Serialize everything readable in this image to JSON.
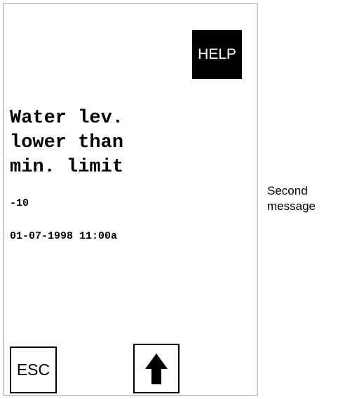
{
  "screen": {
    "help_label": "HELP",
    "message_lines": [
      "Water lev.",
      "lower than",
      "min. limit"
    ],
    "value": "-10",
    "timestamp": "01-07-1998 11:00a",
    "esc_label": "ESC",
    "scroll_button_icon": "up-arrow-icon"
  },
  "caption": {
    "line1": "Second",
    "line2": "message"
  }
}
